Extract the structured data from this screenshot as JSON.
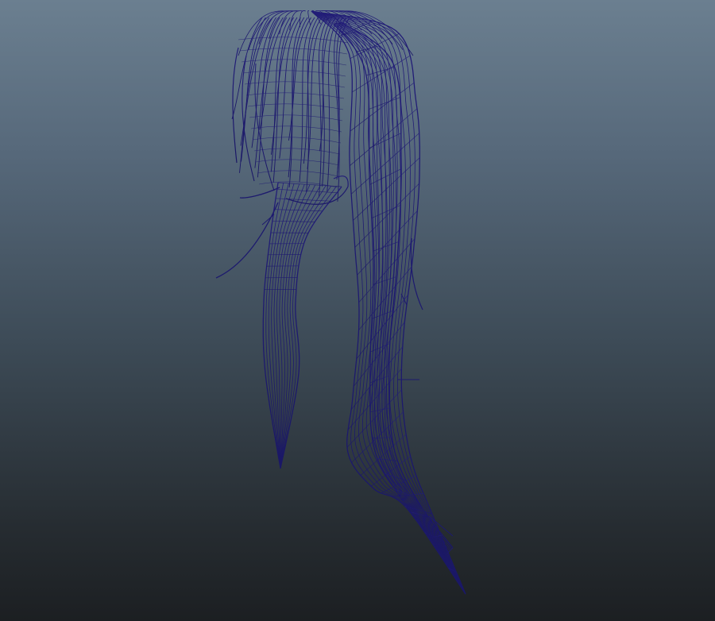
{
  "viewport": {
    "background_top": "#6b7f90",
    "background_bottom": "#1c1f22",
    "wire_color": "#1f1c72"
  },
  "object": {
    "name": "hair-mesh",
    "display_mode": "wireframe",
    "parts": [
      "bangs",
      "front-strand",
      "main-hair-body",
      "stray-strands"
    ]
  }
}
